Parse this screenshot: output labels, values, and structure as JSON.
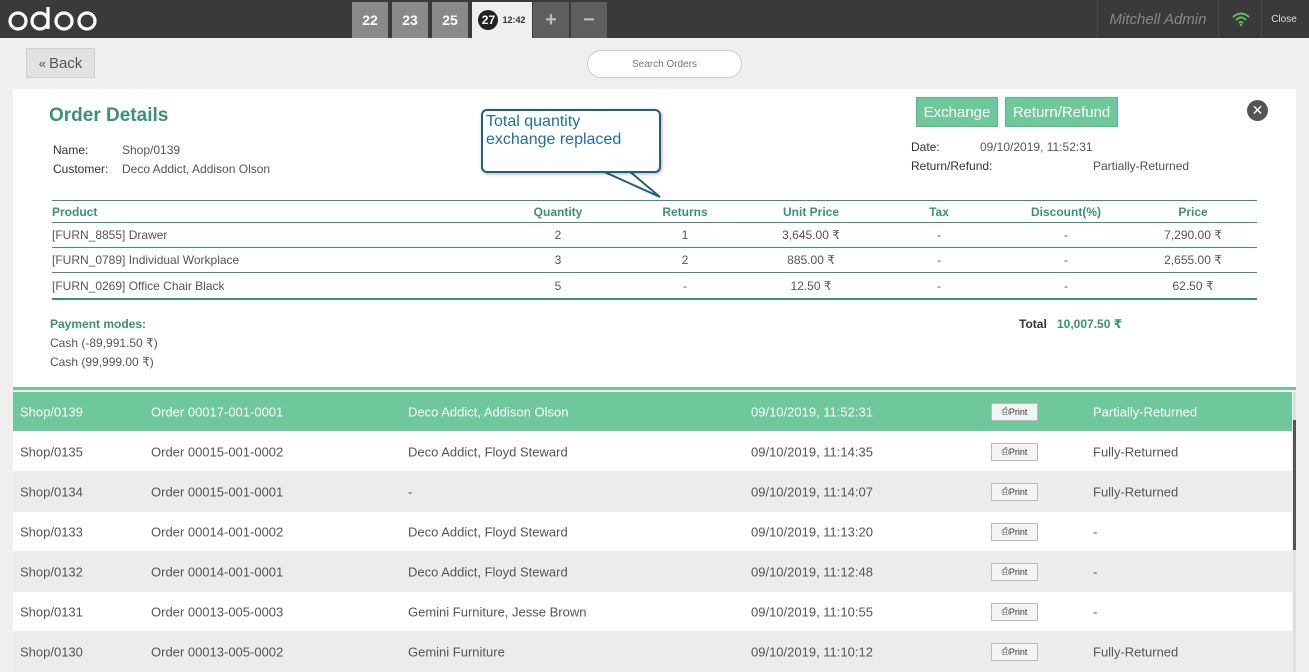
{
  "navbar": {
    "orders": [
      "22",
      "23",
      "25"
    ],
    "active_order": {
      "number": "27",
      "time": "12:42"
    },
    "add_label": "+",
    "remove_label": "−",
    "user": "Mitchell Admin",
    "close_label": "Close"
  },
  "controls": {
    "back_label": "Back",
    "search_placeholder": "Search Orders"
  },
  "details": {
    "title": "Order Details",
    "name_label": "Name:",
    "name_value": "Shop/0139",
    "customer_label": "Customer:",
    "customer_value": "Deco Addict, Addison Olson",
    "date_label": "Date:",
    "date_value": "09/10/2019, 11:52:31",
    "refund_label": "Return/Refund:",
    "refund_value": "Partially-Returned",
    "exchange_btn": "Exchange",
    "return_btn": "Return/Refund",
    "columns": [
      "Product",
      "Quantity",
      "Returns",
      "Unit Price",
      "Tax",
      "Discount(%)",
      "Price"
    ],
    "lines": [
      [
        "[FURN_8855] Drawer",
        "2",
        "1",
        "3,645.00 ₹",
        "-",
        "-",
        "7,290.00 ₹"
      ],
      [
        "[FURN_0789] Individual Workplace",
        "3",
        "2",
        "885.00 ₹",
        "-",
        "-",
        "2,655.00 ₹"
      ],
      [
        "[FURN_0269] Office Chair Black",
        "5",
        "-",
        "12.50 ₹",
        "-",
        "-",
        "62.50 ₹"
      ]
    ],
    "payment_title": "Payment modes:",
    "payments": [
      "Cash (-89,991.50 ₹)",
      "Cash (99,999.00 ₹)"
    ],
    "total_label": "Total",
    "total_value": "10,007.50 ₹"
  },
  "callout": {
    "line1": "Total quantity",
    "line2": "exchange replaced"
  },
  "orders_list": {
    "print_label": "Print",
    "rows": [
      [
        "Shop/0139",
        "Order 00017-001-0001",
        "Deco Addict, Addison Olson",
        "09/10/2019, 11:52:31",
        "Partially-Returned"
      ],
      [
        "Shop/0135",
        "Order 00015-001-0002",
        "Deco Addict, Floyd Steward",
        "09/10/2019, 11:14:35",
        "Fully-Returned"
      ],
      [
        "Shop/0134",
        "Order 00015-001-0001",
        "-",
        "09/10/2019, 11:14:07",
        "Fully-Returned"
      ],
      [
        "Shop/0133",
        "Order 00014-001-0002",
        "Deco Addict, Floyd Steward",
        "09/10/2019, 11:13:20",
        "-"
      ],
      [
        "Shop/0132",
        "Order 00014-001-0001",
        "Deco Addict, Floyd Steward",
        "09/10/2019, 11:12:48",
        "-"
      ],
      [
        "Shop/0131",
        "Order 00013-005-0003",
        "Gemini Furniture, Jesse Brown",
        "09/10/2019, 11:10:55",
        "-"
      ],
      [
        "Shop/0130",
        "Order 00013-005-0002",
        "Gemini Furniture",
        "09/10/2019, 11:10:12",
        "Fully-Returned"
      ]
    ]
  },
  "colors": {
    "accent": "#6ec89b",
    "heading": "#3b8f7c",
    "navbar": "#3a3a3a"
  }
}
